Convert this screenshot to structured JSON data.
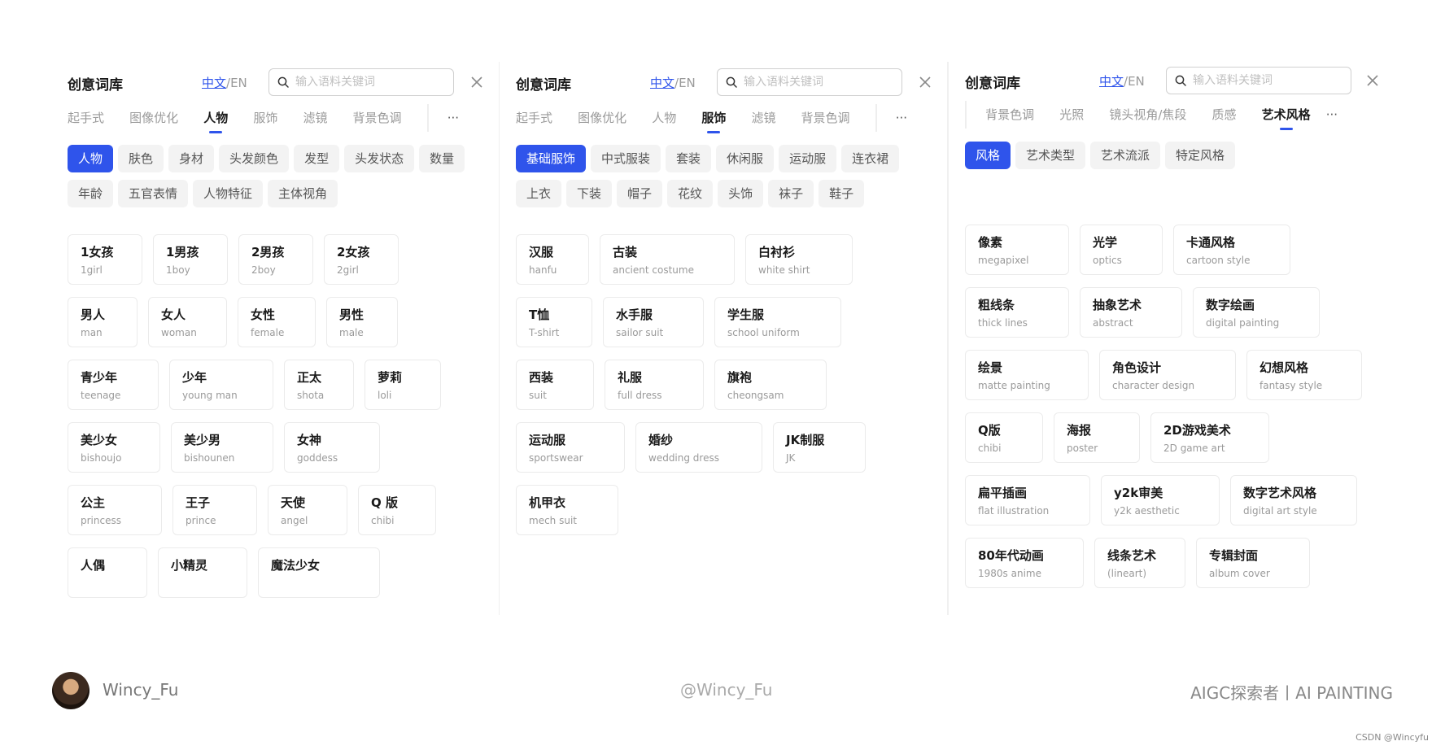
{
  "panels": [
    {
      "title": "创意词库",
      "lang_zh": "中文",
      "lang_sep": "/",
      "lang_en": "EN",
      "search_placeholder": "输入语料关键词",
      "tabs": [
        "起手式",
        "图像优化",
        "人物",
        "服饰",
        "滤镜",
        "背景色调"
      ],
      "active_tab": 2,
      "more": "···",
      "chips": [
        "人物",
        "肤色",
        "身材",
        "头发颜色",
        "发型",
        "头发状态",
        "数量",
        "年龄",
        "五官表情",
        "人物特征",
        "主体视角"
      ],
      "active_chip": 0,
      "cards": [
        {
          "cn": "1女孩",
          "en": "1girl"
        },
        {
          "cn": "1男孩",
          "en": "1boy"
        },
        {
          "cn": "2男孩",
          "en": "2boy"
        },
        {
          "cn": "2女孩",
          "en": "2girl"
        },
        {
          "cn": "男人",
          "en": "man"
        },
        {
          "cn": "女人",
          "en": "woman"
        },
        {
          "cn": "女性",
          "en": "female"
        },
        {
          "cn": "男性",
          "en": "male"
        },
        {
          "cn": "青少年",
          "en": "teenage"
        },
        {
          "cn": "少年",
          "en": "young man"
        },
        {
          "cn": "正太",
          "en": "shota"
        },
        {
          "cn": "萝莉",
          "en": "loli"
        },
        {
          "cn": "美少女",
          "en": "bishoujo"
        },
        {
          "cn": "美少男",
          "en": "bishounen"
        },
        {
          "cn": "女神",
          "en": "goddess"
        },
        {
          "cn": "公主",
          "en": "princess"
        },
        {
          "cn": "王子",
          "en": "prince"
        },
        {
          "cn": "天使",
          "en": "angel"
        },
        {
          "cn": "Q 版",
          "en": "chibi"
        },
        {
          "cn": "人偶",
          "en": ""
        },
        {
          "cn": "小精灵",
          "en": ""
        },
        {
          "cn": "魔法少女",
          "en": ""
        }
      ]
    },
    {
      "title": "创意词库",
      "lang_zh": "中文",
      "lang_sep": "/",
      "lang_en": "EN",
      "search_placeholder": "输入语料关键词",
      "tabs": [
        "起手式",
        "图像优化",
        "人物",
        "服饰",
        "滤镜",
        "背景色调"
      ],
      "active_tab": 3,
      "more": "···",
      "chips": [
        "基础服饰",
        "中式服装",
        "套装",
        "休闲服",
        "运动服",
        "连衣裙",
        "上衣",
        "下装",
        "帽子",
        "花纹",
        "头饰",
        "袜子",
        "鞋子"
      ],
      "active_chip": 0,
      "cards": [
        {
          "cn": "汉服",
          "en": "hanfu"
        },
        {
          "cn": "古装",
          "en": "ancient costume"
        },
        {
          "cn": "白衬衫",
          "en": "white shirt"
        },
        {
          "cn": "T恤",
          "en": "T-shirt"
        },
        {
          "cn": "水手服",
          "en": "sailor suit"
        },
        {
          "cn": "学生服",
          "en": "school uniform"
        },
        {
          "cn": "西装",
          "en": "suit"
        },
        {
          "cn": "礼服",
          "en": "full dress"
        },
        {
          "cn": "旗袍",
          "en": "cheongsam"
        },
        {
          "cn": "运动服",
          "en": "sportswear"
        },
        {
          "cn": "婚纱",
          "en": "wedding dress"
        },
        {
          "cn": "JK制服",
          "en": "JK"
        },
        {
          "cn": "机甲衣",
          "en": "mech suit"
        }
      ]
    },
    {
      "title": "创意词库",
      "lang_zh": "中文",
      "lang_sep": "/",
      "lang_en": "EN",
      "search_placeholder": "输入语料关键词",
      "tabs": [
        "背景色调",
        "光照",
        "镜头视角/焦段",
        "质感",
        "艺术风格"
      ],
      "active_tab": 4,
      "more": "···",
      "chips": [
        "风格",
        "艺术类型",
        "艺术流派",
        "特定风格"
      ],
      "active_chip": 0,
      "cards": [
        {
          "cn": "像素",
          "en": "megapixel"
        },
        {
          "cn": "光学",
          "en": "optics"
        },
        {
          "cn": "卡通风格",
          "en": "cartoon style"
        },
        {
          "cn": "粗线条",
          "en": "thick lines"
        },
        {
          "cn": "抽象艺术",
          "en": "abstract"
        },
        {
          "cn": "数字绘画",
          "en": "digital painting"
        },
        {
          "cn": "绘景",
          "en": "matte painting"
        },
        {
          "cn": "角色设计",
          "en": "character design"
        },
        {
          "cn": "幻想风格",
          "en": "fantasy style"
        },
        {
          "cn": "Q版",
          "en": "chibi"
        },
        {
          "cn": "海报",
          "en": "poster"
        },
        {
          "cn": "2D游戏美术",
          "en": "2D game art"
        },
        {
          "cn": "扁平插画",
          "en": "flat illustration"
        },
        {
          "cn": "y2k审美",
          "en": "y2k aesthetic"
        },
        {
          "cn": "数字艺术风格",
          "en": "digital art style"
        },
        {
          "cn": "80年代动画",
          "en": "1980s anime"
        },
        {
          "cn": "线条艺术",
          "en": "(lineart)"
        },
        {
          "cn": "专辑封面",
          "en": "album cover"
        }
      ]
    }
  ],
  "footer": {
    "author": "Wincy_Fu",
    "handle": "@Wincy_Fu",
    "brand": "AIGC探索者丨AI PAINTING",
    "credit": "CSDN @Wincyfu"
  },
  "colors": {
    "accent": "#2f54eb",
    "chip_bg": "#f3f3f3",
    "card_border": "#ebebeb",
    "muted_text": "#9a9a9a"
  },
  "icons": [
    "search-icon",
    "close-icon",
    "more-icon"
  ]
}
